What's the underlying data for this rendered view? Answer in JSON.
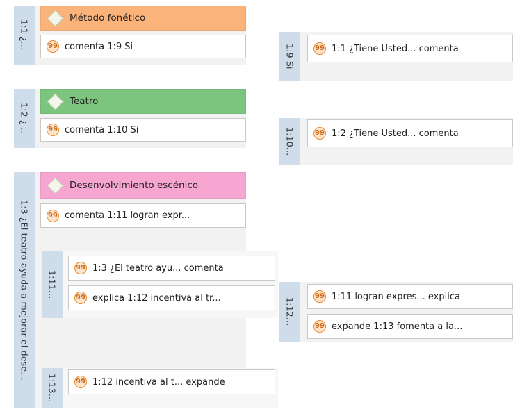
{
  "colors": {
    "orange": "#fbb37a",
    "green": "#7cc57e",
    "pink": "#f7a6d1",
    "vertical_label_bg": "#cfdcea",
    "quote_icon": "#e8892e"
  },
  "groups": [
    {
      "label": "1:1 ¿...",
      "code": "Método fonético",
      "quote": "comenta 1:9 Si"
    },
    {
      "label": "1:2 ¿...",
      "code": "Teatro",
      "quote": "comenta 1:10 Si"
    },
    {
      "label": "1:3 ¿El teatro ayuda a mejorar el dese...",
      "code": "Desenvolvimiento escénico",
      "quote": "comenta 1:11 logran expr..."
    }
  ],
  "subgroups": [
    {
      "label": "1:11...",
      "items": [
        "1:3 ¿El teatro ayu... comenta",
        "explica 1:12 incentiva al tr..."
      ]
    },
    {
      "label": "1:13...",
      "items": [
        "1:12 incentiva al t... expande"
      ]
    }
  ],
  "right_groups": [
    {
      "label": "1:9 Si",
      "items": [
        "1:1 ¿Tiene Usted... comenta"
      ]
    },
    {
      "label": "1:10...",
      "items": [
        "1:2 ¿Tiene Usted... comenta"
      ]
    },
    {
      "label": "1:12...",
      "items": [
        "1:11 logran expres... explica",
        "expande 1:13 fomenta a la..."
      ]
    }
  ],
  "quote_icon_glyph": "99"
}
